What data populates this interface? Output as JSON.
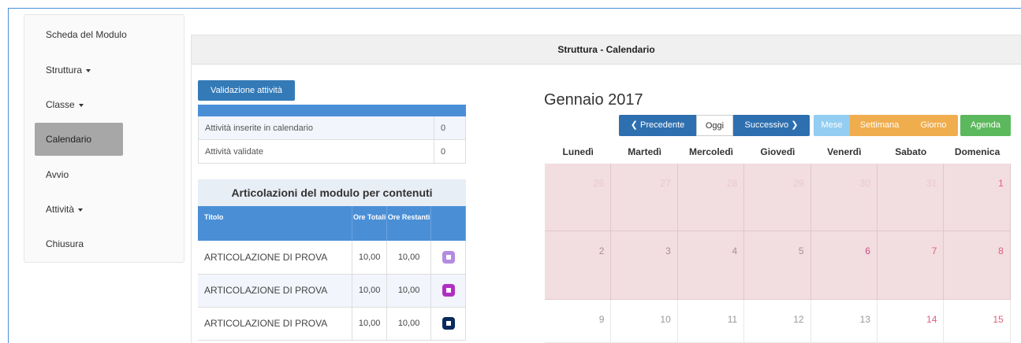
{
  "sidebar": {
    "items": [
      {
        "label": "Scheda del Modulo",
        "caret": false
      },
      {
        "label": "Struttura",
        "caret": true
      },
      {
        "label": "Classe",
        "caret": true
      },
      {
        "label": "Calendario",
        "caret": false,
        "active": true
      },
      {
        "label": "Avvio",
        "caret": false
      },
      {
        "label": "Attività",
        "caret": true
      },
      {
        "label": "Chiusura",
        "caret": false
      }
    ]
  },
  "panel": {
    "title": "Struttura - Calendario"
  },
  "validation": {
    "button_label": "Validazione attività",
    "rows": [
      {
        "label": "Attività inserite in calendario",
        "value": "0"
      },
      {
        "label": "Attività validate",
        "value": "0"
      }
    ]
  },
  "articulations": {
    "title": "Articolazioni del modulo per contenuti",
    "headers": {
      "title": "Titolo",
      "total": "Ore Totali",
      "remaining": "Ore Restanti"
    },
    "rows": [
      {
        "title": "ARTICOLAZIONE DI PROVA",
        "total": "10,00",
        "remaining": "10,00",
        "color": "#b48be0"
      },
      {
        "title": "ARTICOLAZIONE DI PROVA",
        "total": "10,00",
        "remaining": "10,00",
        "color": "#b02fc2"
      },
      {
        "title": "ARTICOLAZIONE DI PROVA",
        "total": "10,00",
        "remaining": "10,00",
        "color": "#0b2a5c"
      }
    ]
  },
  "calendar": {
    "title": "Gennaio 2017",
    "nav": {
      "prev": "Precedente",
      "today": "Oggi",
      "next": "Successivo"
    },
    "views": {
      "month": "Mese",
      "week": "Settimana",
      "day": "Giorno",
      "agenda": "Agenda"
    },
    "weekdays": [
      "Lunedì",
      "Martedì",
      "Mercoledì",
      "Giovedì",
      "Venerdì",
      "Sabato",
      "Domenica"
    ],
    "weeks": [
      [
        {
          "d": "26",
          "tone": "faded"
        },
        {
          "d": "27",
          "tone": "faded"
        },
        {
          "d": "28",
          "tone": "faded"
        },
        {
          "d": "29",
          "tone": "faded"
        },
        {
          "d": "30",
          "tone": "faded"
        },
        {
          "d": "31",
          "tone": "faded"
        },
        {
          "d": "1",
          "tone": "weekend"
        }
      ],
      [
        {
          "d": "2",
          "tone": "normal"
        },
        {
          "d": "3",
          "tone": "normal"
        },
        {
          "d": "4",
          "tone": "normal"
        },
        {
          "d": "5",
          "tone": "normal"
        },
        {
          "d": "6",
          "tone": "holiday"
        },
        {
          "d": "7",
          "tone": "weekend"
        },
        {
          "d": "8",
          "tone": "weekend"
        }
      ],
      [
        {
          "d": "9",
          "tone": "normal"
        },
        {
          "d": "10",
          "tone": "normal"
        },
        {
          "d": "11",
          "tone": "normal"
        },
        {
          "d": "12",
          "tone": "normal"
        },
        {
          "d": "13",
          "tone": "normal"
        },
        {
          "d": "14",
          "tone": "weekend"
        },
        {
          "d": "15",
          "tone": "weekend"
        }
      ]
    ]
  },
  "colors": {
    "primary": "#337ab7",
    "warning": "#f0ad4e",
    "success": "#5cb85c",
    "info_light": "#93cdf2",
    "closed_day": "#f2dde0"
  }
}
